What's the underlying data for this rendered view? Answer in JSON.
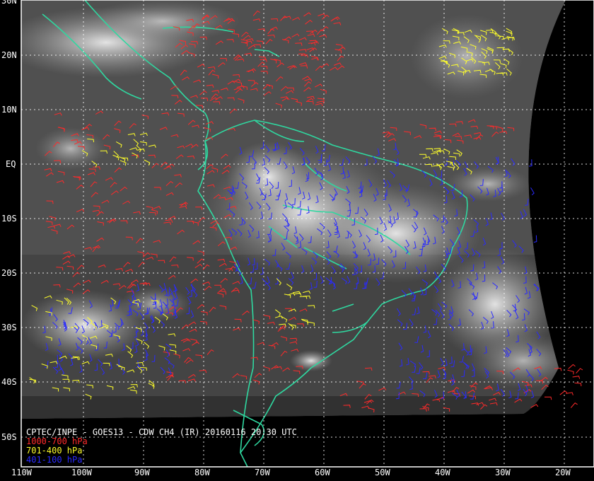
{
  "caption": "CPTEC/INPE - GOES13 - CDW CH4 (IR) 20160116 20:30 UTC",
  "legend": [
    {
      "label": "1000-700 hPa",
      "color": "#ff2a2a"
    },
    {
      "label": "701-400 hPa",
      "color": "#ffff2a"
    },
    {
      "label": "401-100 hPa",
      "color": "#2a2aff"
    }
  ],
  "lat_labels": [
    "30N",
    "20N",
    "10N",
    "EQ",
    "10S",
    "20S",
    "30S",
    "40S",
    "50S"
  ],
  "lon_labels": [
    "110W",
    "100W",
    "90W",
    "80W",
    "70W",
    "60W",
    "50W",
    "40W",
    "30W",
    "20W"
  ],
  "colors": {
    "coastline": "#2fd8a0",
    "grid": "#ffffff",
    "background": "#000000"
  }
}
